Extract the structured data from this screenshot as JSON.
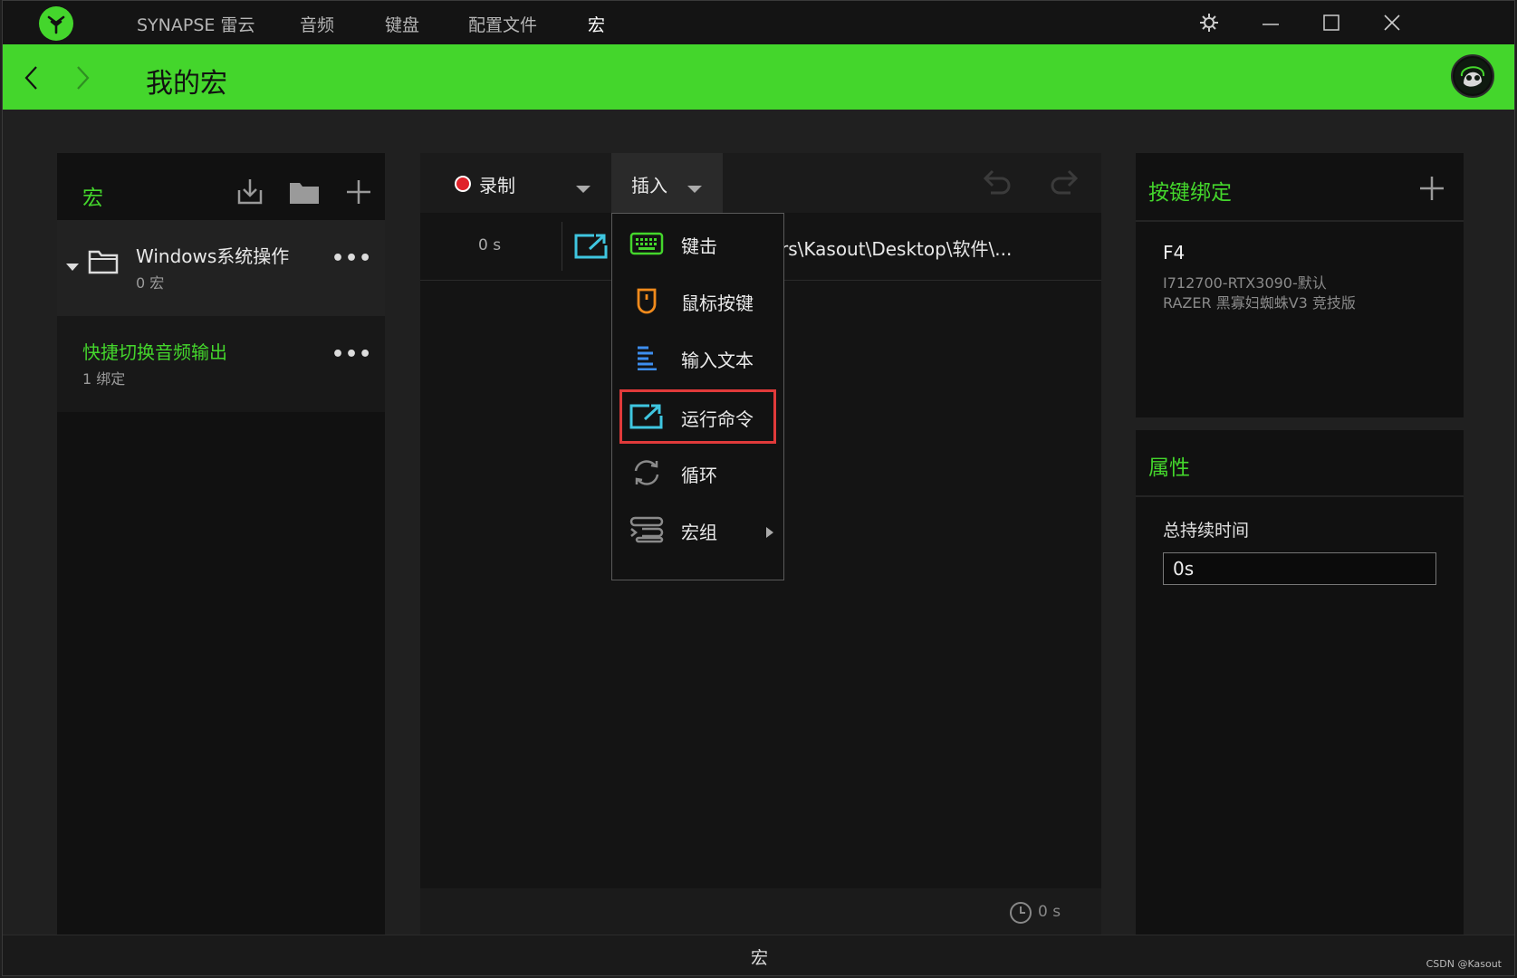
{
  "titlebar": {
    "tabs": [
      "SYNAPSE 雷云",
      "音频",
      "键盘",
      "配置文件",
      "宏"
    ],
    "active_tab": "宏"
  },
  "header": {
    "title": "我的宏"
  },
  "left_panel": {
    "title": "宏",
    "folder": {
      "name": "Windows系统操作",
      "count": "0 宏"
    },
    "macro": {
      "name": "快捷切换音频输出",
      "bindings": "1 绑定"
    }
  },
  "center_panel": {
    "record_label": "录制",
    "insert_label": "插入",
    "event": {
      "time": "0 s",
      "path": "rs\\Kasout\\Desktop\\软件\\..."
    },
    "total_time": "0 s"
  },
  "insert_menu": {
    "items": [
      "键击",
      "鼠标按键",
      "输入文本",
      "运行命令",
      "循环",
      "宏组"
    ],
    "highlighted": "运行命令"
  },
  "right_panel": {
    "binding_title": "按键绑定",
    "binding": {
      "key": "F4",
      "profile": "I712700-RTX3090-默认",
      "device": "RAZER 黑寡妇蜘蛛V3 竞技版"
    },
    "properties_title": "属性",
    "duration_label": "总持续时间",
    "duration_value": "0s"
  },
  "statusbar": {
    "label": "宏",
    "watermark": "CSDN @Kasout"
  },
  "colors": {
    "accent": "#44d62c",
    "highlight_border": "#e03a3a"
  }
}
